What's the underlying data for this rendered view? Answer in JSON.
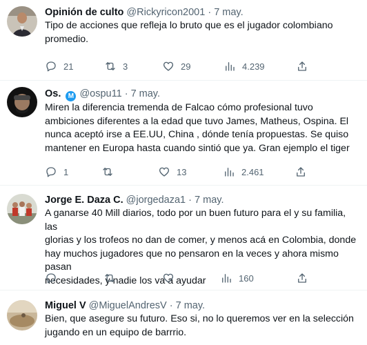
{
  "tweets": [
    {
      "name": "Opinión de culto",
      "handle": "@Rickyricon2001",
      "sep": "·",
      "date": "7 may.",
      "text": "Tipo de acciones que refleja lo bruto que es el jugador colombiano\npromedio.",
      "replies": "21",
      "retweets": "3",
      "likes": "29",
      "views": "4.239"
    },
    {
      "name": "Os.",
      "badge": "M",
      "handle": "@ospu11",
      "sep": "·",
      "date": "7 may.",
      "text": "Miren la diferencia tremenda de Falcao cómo profesional tuvo\nambiciones diferentes a la edad que tuvo James, Matheus, Ospina. El\nnunca aceptó irse a EE.UU, China , dónde tenía propuestas. Se quiso\nmantener en Europa hasta cuando sintió que ya. Gran ejemplo el tiger",
      "replies": "1",
      "retweets": "",
      "likes": "13",
      "views": "2.461"
    },
    {
      "name": "Jorge E. Daza C.",
      "handle": "@jorgedaza1",
      "sep": "·",
      "date": "7 may.",
      "text": "A ganarse 40 Mill diarios, todo por un buen futuro para el y su familia,  las\nglorias y los trofeos no dan de comer, y menos acá en Colombia, donde\nhay muchos jugadores que no pensaron en la veces y ahora mismo pasan\nnecesidades, y nadie los va a ayudar",
      "replies": "",
      "retweets": "",
      "likes": "",
      "views": "160"
    },
    {
      "name": "Miguel V",
      "handle": "@MiguelAndresV",
      "sep": "·",
      "date": "7 may.",
      "text": "Bien, que asegure su futuro. Eso si, no lo queremos ver en la selección\njugando en un equipo de barrrio."
    }
  ]
}
